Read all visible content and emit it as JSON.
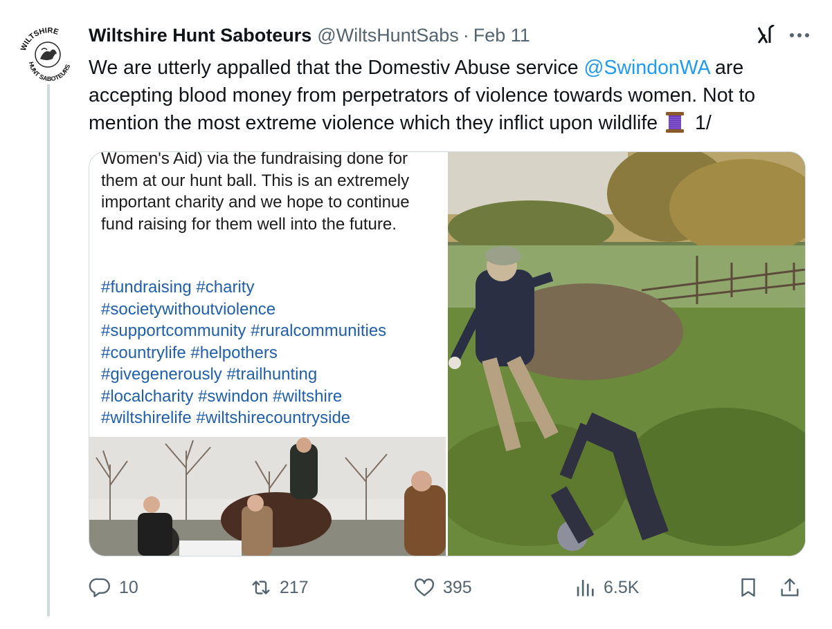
{
  "account": {
    "display_name": "Wiltshire Hunt Saboteurs",
    "handle": "@WiltsHuntSabs",
    "separator": "·",
    "date": "Feb 11",
    "avatar_text_top": "WILTSHIRE",
    "avatar_text_left": "HUNT",
    "avatar_text_bottom": "SABOTEURS"
  },
  "tweet": {
    "text_before_mention": "We are utterly appalled that the Domestiv Abuse service ",
    "mention": "@SwindonWA",
    "text_after_mention": " are accepting blood money from perpetrators of violence towards women.  Not to mention the most extreme violence which they inflict upon wildlife ",
    "thread_marker": " 1/",
    "emoji_icon": "spool-of-thread-icon"
  },
  "embedded_post": {
    "body": "Women's Aid) via the fundraising done for them at our hunt ball. This is an extremely important charity and we hope to continue fund raising for them well into the future.",
    "hashtags": [
      "#fundraising #charity",
      "#societywithoutviolence",
      "#supportcommunity #ruralcommunities",
      "#countrylife #helpothers",
      "#givegenerously #trailhunting",
      "#localcharity #swindon #wiltshire",
      "#wiltshirelife #wiltshirecountryside"
    ]
  },
  "metrics": {
    "replies": "10",
    "reposts": "217",
    "likes": "395",
    "views": "6.5K"
  },
  "icons": {
    "header": [
      "grok-icon",
      "more-options-icon"
    ],
    "actions": [
      "reply-icon",
      "repost-icon",
      "like-icon",
      "views-icon",
      "bookmark-icon",
      "share-icon"
    ]
  },
  "colors": {
    "link": "#1d9bf0",
    "hashtag": "#1f5fae",
    "secondary_text": "#536471",
    "primary_text": "#0f1419"
  }
}
